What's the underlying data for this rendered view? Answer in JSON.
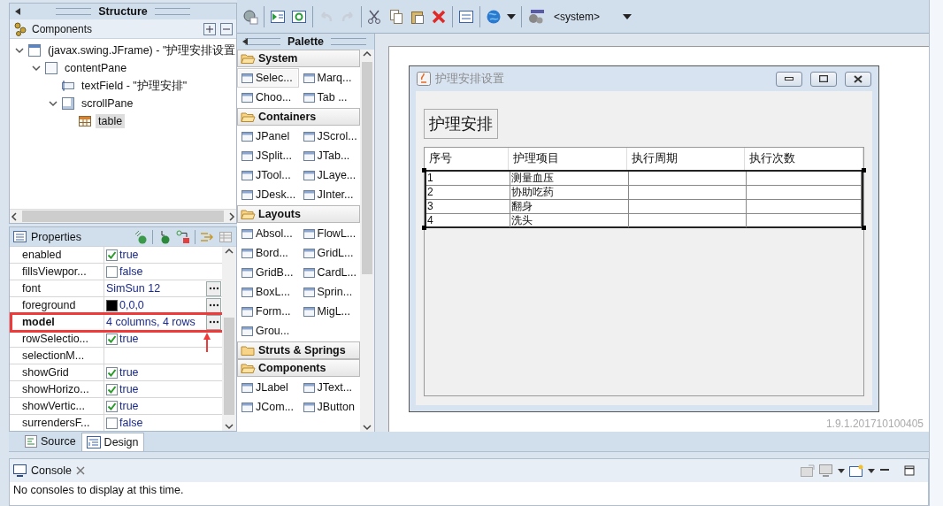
{
  "structure": {
    "title": "Structure",
    "components_label": "Components",
    "tree": [
      {
        "label": "(javax.swing.JFrame) - \"护理安排设置",
        "kind": "frame",
        "expanded": true,
        "selected": false,
        "children": [
          {
            "label": "contentPane",
            "kind": "panel",
            "expanded": true,
            "selected": false,
            "children": [
              {
                "label": "textField - \"护理安排\"",
                "kind": "textfield",
                "selected": false
              },
              {
                "label": "scrollPane",
                "kind": "scrollpane",
                "expanded": true,
                "selected": false,
                "children": [
                  {
                    "label": "table",
                    "kind": "table",
                    "selected": true
                  }
                ]
              }
            ]
          }
        ]
      }
    ]
  },
  "properties": {
    "title": "Properties",
    "rows": [
      {
        "name": "enabled",
        "kind": "checkbox",
        "value": "true",
        "checked": true,
        "bold": false,
        "editor_button": false,
        "annotated": false
      },
      {
        "name": "fillsViewpor...",
        "kind": "checkbox",
        "value": "false",
        "checked": false,
        "bold": false,
        "editor_button": false,
        "annotated": false
      },
      {
        "name": "font",
        "kind": "text",
        "value": "SimSun 12",
        "bold": false,
        "editor_button": true,
        "annotated": false
      },
      {
        "name": "foreground",
        "kind": "color",
        "value": "0,0,0",
        "color": "#000000",
        "bold": false,
        "editor_button": true,
        "annotated": false
      },
      {
        "name": "model",
        "kind": "text",
        "value": "4 columns, 4 rows",
        "bold": true,
        "editor_button": true,
        "annotated": true
      },
      {
        "name": "rowSelectio...",
        "kind": "checkbox",
        "value": "true",
        "checked": true,
        "bold": false,
        "editor_button": false,
        "annotated": false
      },
      {
        "name": "selectionM...",
        "kind": "empty",
        "bold": false,
        "editor_button": false,
        "annotated": false
      },
      {
        "name": "showGrid",
        "kind": "checkbox",
        "value": "true",
        "checked": true,
        "bold": false,
        "editor_button": false,
        "annotated": false
      },
      {
        "name": "showHorizo...",
        "kind": "checkbox",
        "value": "true",
        "checked": true,
        "bold": false,
        "editor_button": false,
        "annotated": false
      },
      {
        "name": "showVertic...",
        "kind": "checkbox",
        "value": "true",
        "checked": true,
        "bold": false,
        "editor_button": false,
        "annotated": false
      },
      {
        "name": "surrendersF...",
        "kind": "checkbox",
        "value": "false",
        "checked": false,
        "bold": false,
        "editor_button": false,
        "annotated": false
      }
    ]
  },
  "toolbar": {
    "runtime": "<system>"
  },
  "palette": {
    "title": "Palette",
    "groups": [
      {
        "label": "System",
        "expanded": true,
        "items": [
          {
            "label": "Selec...",
            "selected": true
          },
          {
            "label": "Marq...",
            "selected": false
          },
          {
            "label": "Choo...",
            "selected": false
          },
          {
            "label": "Tab ...",
            "selected": false
          }
        ]
      },
      {
        "label": "Containers",
        "expanded": true,
        "items": [
          {
            "label": "JPanel",
            "selected": false
          },
          {
            "label": "JScrol...",
            "selected": false
          },
          {
            "label": "JSplit...",
            "selected": false
          },
          {
            "label": "JTab...",
            "selected": false
          },
          {
            "label": "JTool...",
            "selected": false
          },
          {
            "label": "JLaye...",
            "selected": false
          },
          {
            "label": "JDesk...",
            "selected": false
          },
          {
            "label": "JInter...",
            "selected": false
          }
        ]
      },
      {
        "label": "Layouts",
        "expanded": true,
        "items": [
          {
            "label": "Absol...",
            "selected": false
          },
          {
            "label": "FlowL...",
            "selected": false
          },
          {
            "label": "Bord...",
            "selected": false
          },
          {
            "label": "GridL...",
            "selected": false
          },
          {
            "label": "GridB...",
            "selected": false
          },
          {
            "label": "CardL...",
            "selected": false
          },
          {
            "label": "BoxL...",
            "selected": false
          },
          {
            "label": "Sprin...",
            "selected": false
          },
          {
            "label": "Form...",
            "selected": false
          },
          {
            "label": "MigL...",
            "selected": false
          },
          {
            "label": "Grou...",
            "selected": false
          }
        ]
      },
      {
        "label": "Struts & Springs",
        "expanded": false
      },
      {
        "label": "Components",
        "expanded": true,
        "items": [
          {
            "label": "JLabel",
            "selected": false
          },
          {
            "label": "JText...",
            "selected": false
          },
          {
            "label": "JCom...",
            "selected": false
          },
          {
            "label": "JButton",
            "selected": false
          }
        ]
      }
    ]
  },
  "design": {
    "frame": {
      "title": "护理安排设置",
      "text_field": "护理安排",
      "table": {
        "columns": [
          "序号",
          "护理项目",
          "执行周期",
          "执行次数"
        ],
        "rows": [
          [
            "1",
            "测量血压"
          ],
          [
            "2",
            "协助吃药"
          ],
          [
            "3",
            "翻身"
          ],
          [
            "4",
            "洗头"
          ]
        ]
      }
    },
    "version": "1.9.1.201710100405"
  },
  "editor_tabs": [
    {
      "label": "Source",
      "selected": false
    },
    {
      "label": "Design",
      "selected": true
    }
  ],
  "console": {
    "tab": "Console",
    "message": "No consoles to display at this time."
  }
}
